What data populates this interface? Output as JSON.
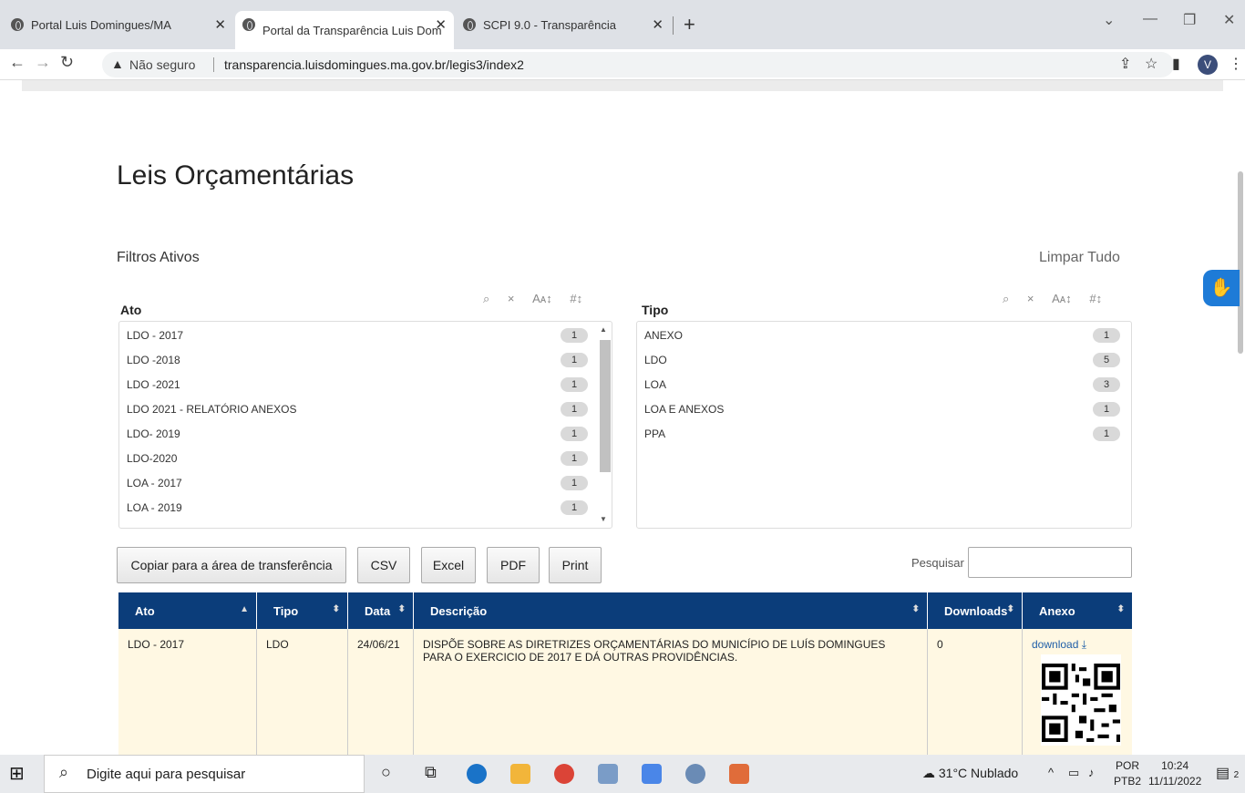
{
  "browser": {
    "tabs": [
      {
        "label": "Portal Luis Domingues/MA",
        "active": false
      },
      {
        "label": "Portal da Transparência Luis Dom",
        "active": true
      },
      {
        "label": "SCPI 9.0 - Transparência",
        "active": false
      }
    ],
    "address": {
      "security_text": "Não seguro",
      "url": "transparencia.luisdomingues.ma.gov.br/legis3/index2"
    },
    "profile_initial": "V"
  },
  "page": {
    "title": "Leis Orçamentárias",
    "filters_label": "Filtros Ativos",
    "clear_all": "Limpar Tudo"
  },
  "facets": {
    "ato": {
      "title": "Ato",
      "items": [
        {
          "label": "LDO - 2017",
          "count": "1"
        },
        {
          "label": "LDO -2018",
          "count": "1"
        },
        {
          "label": "LDO -2021",
          "count": "1"
        },
        {
          "label": "LDO 2021 - RELATÓRIO ANEXOS",
          "count": "1"
        },
        {
          "label": "LDO- 2019",
          "count": "1"
        },
        {
          "label": "LDO-2020",
          "count": "1"
        },
        {
          "label": "LOA - 2017",
          "count": "1"
        },
        {
          "label": "LOA - 2019",
          "count": "1"
        }
      ]
    },
    "tipo": {
      "title": "Tipo",
      "items": [
        {
          "label": "ANEXO",
          "count": "1"
        },
        {
          "label": "LDO",
          "count": "5"
        },
        {
          "label": "LOA",
          "count": "3"
        },
        {
          "label": "LOA E ANEXOS",
          "count": "1"
        },
        {
          "label": "PPA",
          "count": "1"
        }
      ]
    },
    "tools": {
      "search": "⌕",
      "clear": "×",
      "sort_alpha": "Aᴀ↕",
      "sort_num": "#↕"
    }
  },
  "buttons": {
    "copy": "Copiar para a área de transferência",
    "csv": "CSV",
    "excel": "Excel",
    "pdf": "PDF",
    "print": "Print"
  },
  "search": {
    "label": "Pesquisar",
    "value": ""
  },
  "table": {
    "columns": [
      "Ato",
      "Tipo",
      "Data",
      "Descrição",
      "Downloads",
      "Anexo"
    ],
    "rows": [
      {
        "ato": "LDO - 2017",
        "tipo": "LDO",
        "data": "24/06/21",
        "descricao": "DISPÕE SOBRE AS DIRETRIZES ORÇAMENTÁRIAS DO MUNICÍPIO DE LUÍS DOMINGUES PARA O EXERCICIO DE  2017 E DÁ OUTRAS PROVIDÊNCIAS.",
        "downloads": "0",
        "anexo": "download"
      }
    ]
  },
  "taskbar": {
    "search_placeholder": "Digite aqui para pesquisar",
    "weather": "31°C  Nublado",
    "lang_top": "POR",
    "lang_bottom": "PTB2",
    "time": "10:24",
    "date": "11/11/2022",
    "notifications": "2"
  },
  "colors": {
    "table_header": "#0b3d7a",
    "row_highlight": "#fff8e3",
    "link": "#1f5fa8",
    "accessibility": "#1e7bd7"
  }
}
